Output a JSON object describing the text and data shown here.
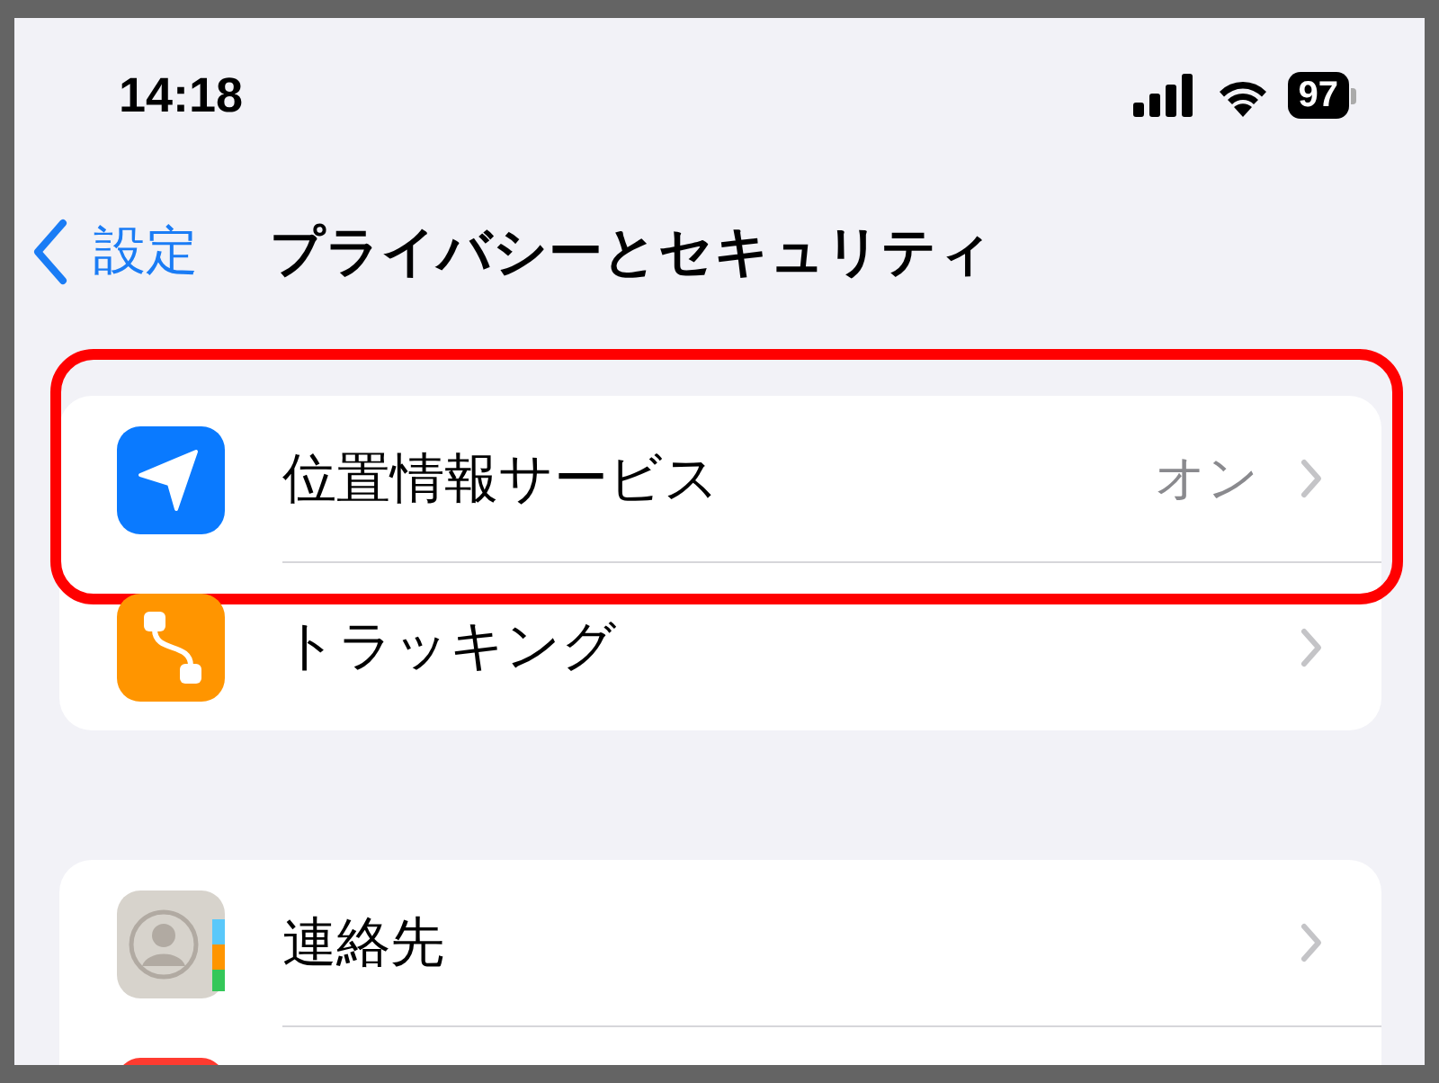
{
  "status_bar": {
    "time": "14:18",
    "battery": "97"
  },
  "nav": {
    "back_label": "設定",
    "title": "プライバシーとセキュリティ"
  },
  "groups": [
    {
      "rows": [
        {
          "kind": "location",
          "label": "位置情報サービス",
          "value": "オン",
          "highlighted": true
        },
        {
          "kind": "tracking",
          "label": "トラッキング",
          "highlighted": false
        }
      ]
    },
    {
      "rows": [
        {
          "kind": "contacts",
          "label": "連絡先",
          "highlighted": false
        },
        {
          "kind": "partial",
          "highlighted": false
        }
      ]
    }
  ]
}
